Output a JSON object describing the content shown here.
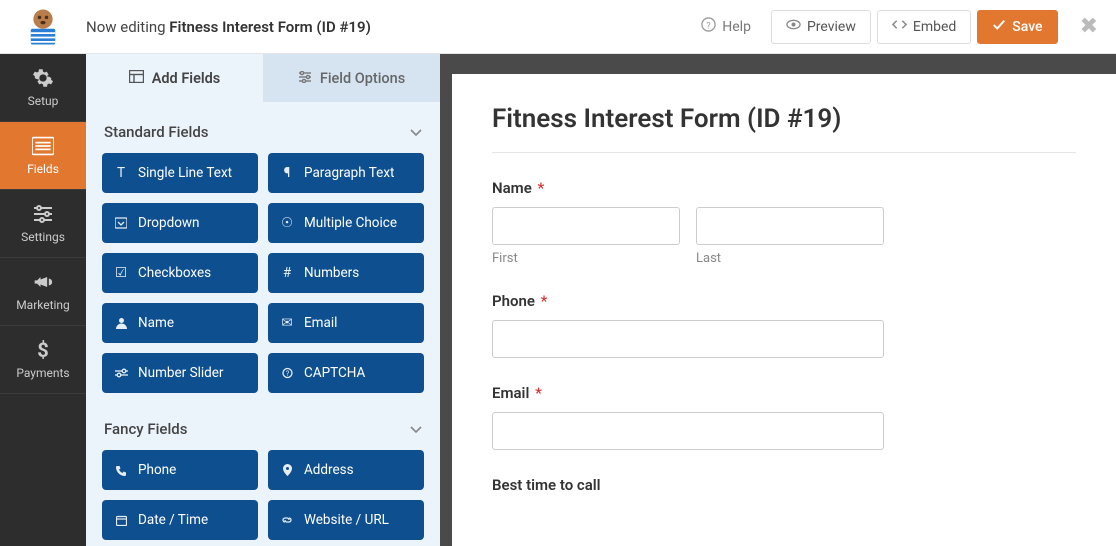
{
  "header": {
    "editing_prefix": "Now editing ",
    "form_name": "Fitness Interest Form (ID #19)",
    "help": "Help",
    "preview": "Preview",
    "embed": "Embed",
    "save": "Save"
  },
  "nav": {
    "setup": "Setup",
    "fields": "Fields",
    "settings": "Settings",
    "marketing": "Marketing",
    "payments": "Payments"
  },
  "panel": {
    "tab_add": "Add Fields",
    "tab_options": "Field Options",
    "section_standard": "Standard Fields",
    "section_fancy": "Fancy Fields",
    "standard": {
      "single_line": "Single Line Text",
      "paragraph": "Paragraph Text",
      "dropdown": "Dropdown",
      "multiple_choice": "Multiple Choice",
      "checkboxes": "Checkboxes",
      "numbers": "Numbers",
      "name": "Name",
      "email": "Email",
      "number_slider": "Number Slider",
      "captcha": "CAPTCHA"
    },
    "fancy": {
      "phone": "Phone",
      "address": "Address",
      "datetime": "Date / Time",
      "website": "Website / URL"
    }
  },
  "form": {
    "title": "Fitness Interest Form (ID #19)",
    "name_label": "Name",
    "first": "First",
    "last": "Last",
    "phone_label": "Phone",
    "email_label": "Email",
    "besttime_label": "Best time to call"
  }
}
